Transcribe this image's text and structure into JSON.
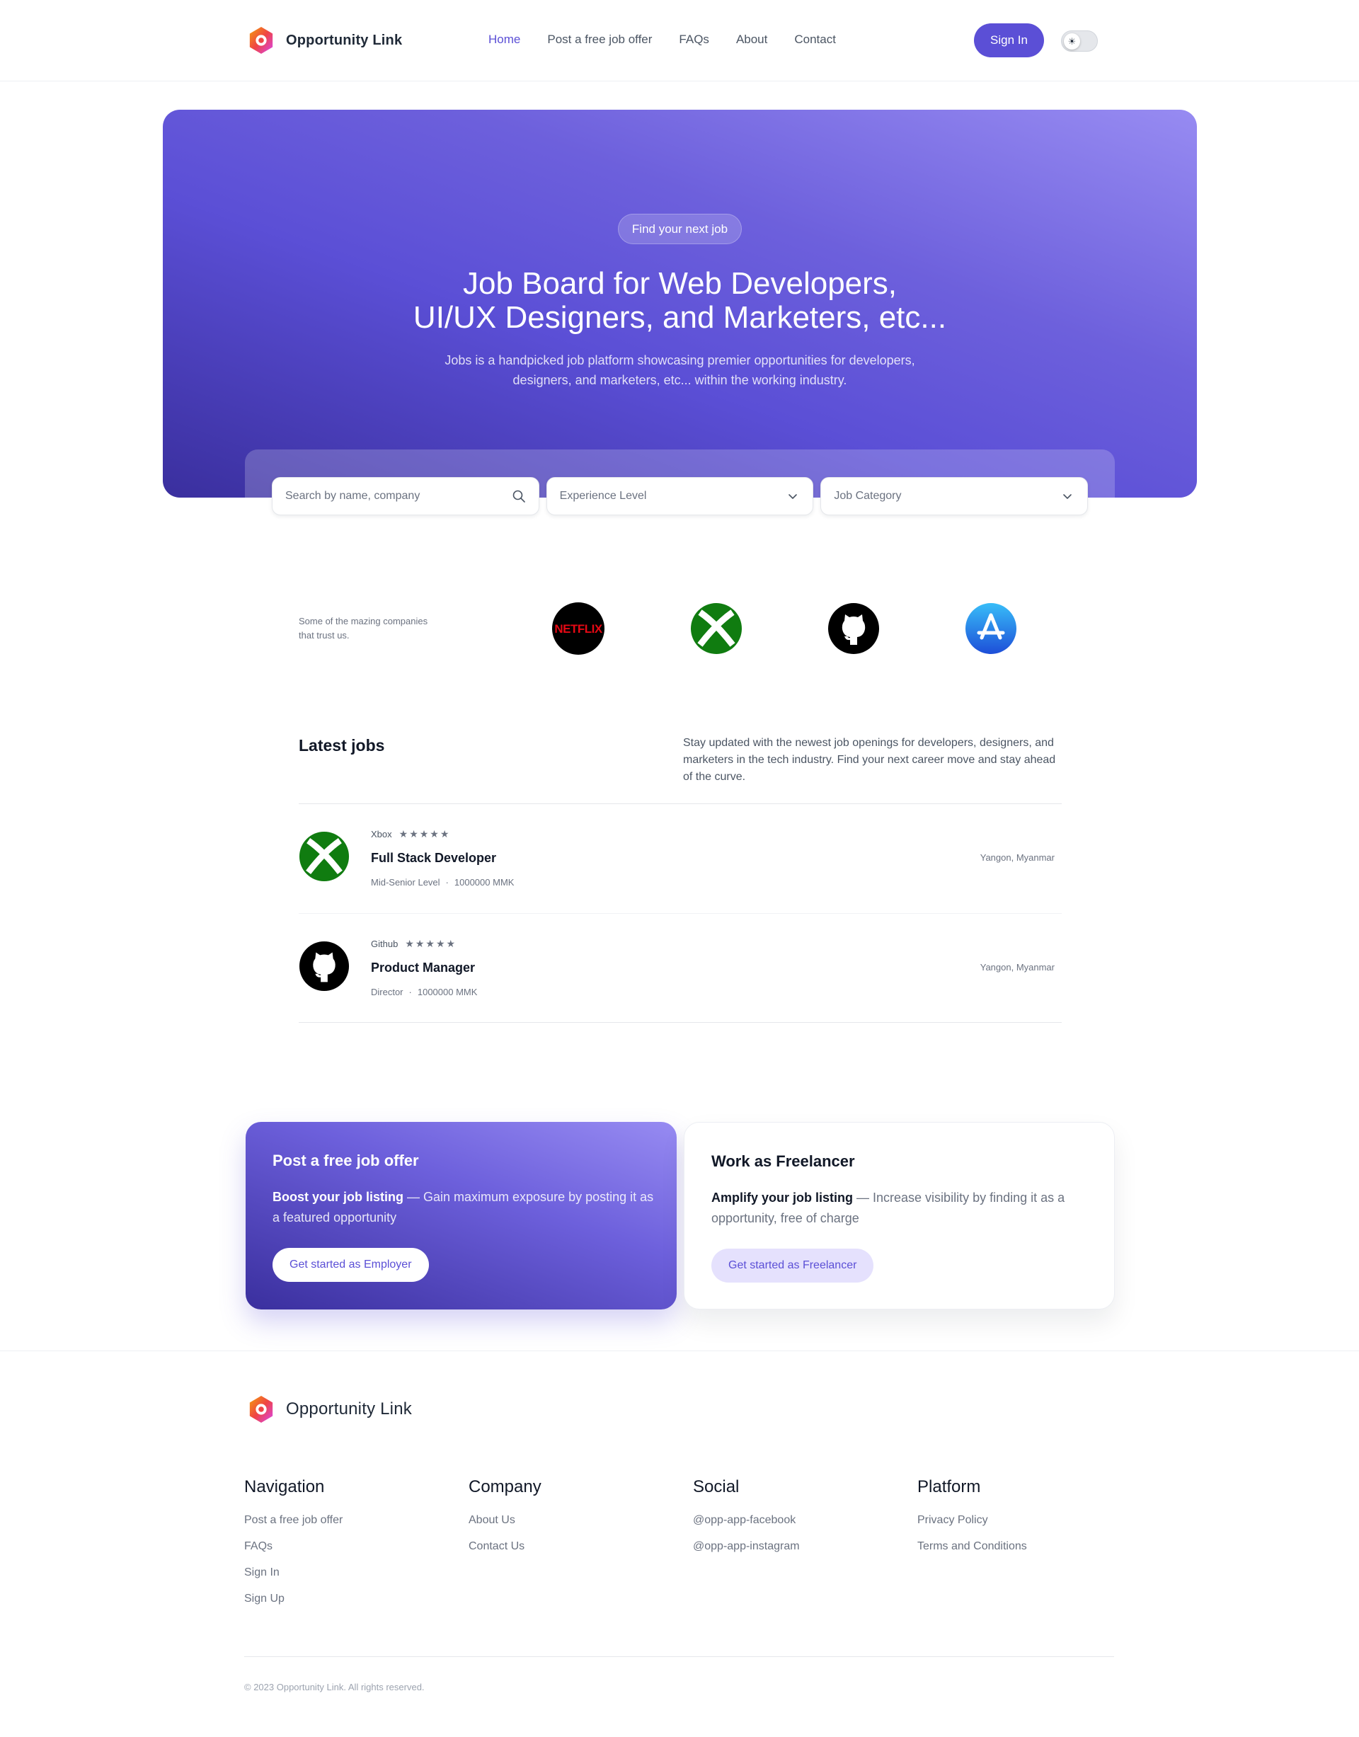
{
  "brand": {
    "name": "Opportunity Link"
  },
  "nav": {
    "items": [
      {
        "label": "Home",
        "active": true
      },
      {
        "label": "Post a free job offer"
      },
      {
        "label": "FAQs"
      },
      {
        "label": "About"
      },
      {
        "label": "Contact"
      }
    ],
    "sign_in": "Sign In",
    "theme_toggle_icon": "sun-icon"
  },
  "hero": {
    "badge": "Find your next job",
    "title_line1": "Job Board for Web Developers,",
    "title_line2": "UI/UX Designers, and Marketers, etc...",
    "subtitle": "Jobs is a handpicked job platform showcasing premier opportunities for developers, designers, and marketers, etc... within the working industry."
  },
  "search": {
    "placeholder": "Search by name, company",
    "experience_label": "Experience Level",
    "category_label": "Job Category"
  },
  "trust": {
    "text": "Some of the mazing companies that trust us.",
    "companies": [
      "Netflix",
      "Xbox",
      "Github",
      "App Store"
    ]
  },
  "latest": {
    "title": "Latest jobs",
    "description": "Stay updated with the newest job openings for developers, designers, and marketers in the tech industry. Find your next career move and stay ahead of the curve.",
    "jobs": [
      {
        "company": "Xbox",
        "rating": "★★★★★",
        "title": "Full Stack Developer",
        "level": "Mid-Senior Level",
        "salary": "1000000 MMK",
        "location": "Yangon, Myanmar"
      },
      {
        "company": "Github",
        "rating": "★★★★★",
        "title": "Product Manager",
        "level": "Director",
        "salary": "1000000 MMK",
        "location": "Yangon, Myanmar"
      }
    ]
  },
  "cta": {
    "employer": {
      "title": "Post a free job offer",
      "lead": "Boost your job listing",
      "text": " — Gain maximum exposure by posting it as a featured opportunity",
      "button": "Get started as Employer"
    },
    "freelancer": {
      "title": "Work as Freelancer",
      "lead": "Amplify your job listing",
      "text": " — Increase visibility by finding it as a opportunity, free of charge",
      "button": "Get started as Freelancer"
    }
  },
  "footer": {
    "columns": [
      {
        "title": "Navigation",
        "links": [
          "Post a free job offer",
          "FAQs",
          "Sign In",
          "Sign Up"
        ]
      },
      {
        "title": "Company",
        "links": [
          "About Us",
          "Contact Us"
        ]
      },
      {
        "title": "Social",
        "links": [
          "@opp-app-facebook",
          "@opp-app-instagram"
        ]
      },
      {
        "title": "Platform",
        "links": [
          "Privacy Policy",
          "Terms and Conditions"
        ]
      }
    ],
    "copyright": "© 2023 Opportunity Link. All rights reserved."
  },
  "colors": {
    "accent": "#5b4fd6",
    "accent_light": "#e5e1fd",
    "text": "#1f2937",
    "muted": "#6b7280"
  }
}
